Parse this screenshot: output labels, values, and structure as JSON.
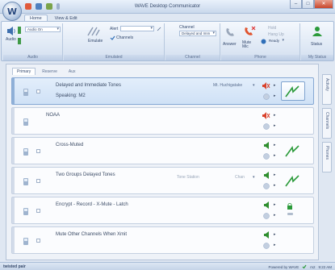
{
  "window": {
    "title": "WAVE Desktop Communicator",
    "app_logo": "W",
    "minimize": "–",
    "maximize": "□",
    "close": "✕"
  },
  "ribbon": {
    "tabs": [
      "Home",
      "View & Edit"
    ],
    "audio_group": {
      "label": "Audio",
      "audio_button": "Audio",
      "audio_mode": "Audio On"
    },
    "emulated_group": {
      "label": "Emulated",
      "emulate_label": "Emulate",
      "alert_label": "Alert",
      "channels_label": "Channels"
    },
    "channel_group": {
      "label": "Channel",
      "channel_label": "Channel",
      "channel_value": "Delayed and Imm"
    },
    "phone_group": {
      "label": "Phone",
      "answer_label": "Answer",
      "hangup_label": "Hang Up",
      "hold_label": "Hold",
      "mute_mic_label": "Mute Mic",
      "ready_label": "Ready"
    },
    "status_group": {
      "label": "My Status",
      "status_label": "Status"
    }
  },
  "content": {
    "sub_tabs": [
      "Primary",
      "Reserve",
      "Aux"
    ],
    "side_tabs": [
      "Activity",
      "Channels",
      "Phones"
    ],
    "channels": [
      {
        "name": "Delayed and Immediate Tones",
        "sub": "Speaking: M2",
        "talker": "Mt. Huchigatake",
        "ptt_icon": "ptt-boxed-icon"
      },
      {
        "name": "NOAA",
        "sub": "",
        "talker": "",
        "ptt_icon": ""
      },
      {
        "name": "Cross-Muted",
        "sub": "",
        "talker": "",
        "ptt_icon": "ptt-icon"
      },
      {
        "name": "Two Groups Delayed Tones",
        "sub": "",
        "talker": "",
        "ghost_left": "Tone Station",
        "ghost_right": "Chan",
        "ptt_icon": "ptt-icon"
      },
      {
        "name": "Encrypt - Record - X-Mute - Latch",
        "sub": "",
        "talker": "",
        "ptt_icon": "ptt-icon"
      },
      {
        "name": "Mute Other Channels When Xmit",
        "sub": "",
        "talker": "",
        "ptt_icon": ""
      }
    ]
  },
  "statusbar": {
    "brand": "twisted pair",
    "powered_by": "Powered by WAVE",
    "user": "m2",
    "time": "9:22 AM"
  },
  "colors": {
    "accent": "#2f6fb8",
    "speaker_green": "#2f8f2f",
    "mute_red": "#d9412b",
    "ptt_green": "#2b9a3a"
  }
}
